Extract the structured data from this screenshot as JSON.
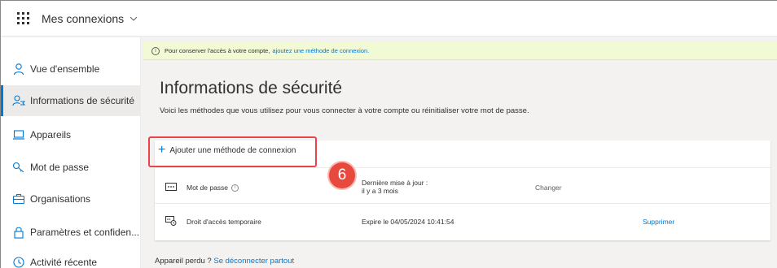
{
  "app": {
    "title": "Mes connexions"
  },
  "sidebar": {
    "items": [
      {
        "label": "Vue d'ensemble",
        "icon": "person-icon"
      },
      {
        "label": "Informations de sécurité",
        "icon": "security-info-icon",
        "active": true
      },
      {
        "label": "Appareils",
        "icon": "laptop-icon"
      },
      {
        "label": "Mot de passe",
        "icon": "key-icon"
      },
      {
        "label": "Organisations",
        "icon": "briefcase-icon"
      },
      {
        "label": "Paramètres et confiden...",
        "icon": "lock-icon"
      },
      {
        "label": "Activité récente",
        "icon": "history-icon"
      }
    ]
  },
  "banner": {
    "text": "Pour conserver l'accès à votre compte,",
    "link": "ajoutez une méthode de connexion."
  },
  "main": {
    "title": "Informations de sécurité",
    "description": "Voici les méthodes que vous utilisez pour vous connecter à votre compte ou réinitialiser votre mot de passe.",
    "add_method_label": "Ajouter une méthode de connexion",
    "step_number": "6",
    "methods": [
      {
        "name": "Mot de passe",
        "detail_line1": "Dernière mise à jour :",
        "detail_line2": "il y a 3 mois",
        "action": "Changer"
      },
      {
        "name": "Droit d'accès temporaire",
        "detail": "Expire le 04/05/2024 10:41:54",
        "action": "Supprimer"
      }
    ],
    "lost_device_text": "Appareil perdu ?",
    "lost_device_link": "Se déconnecter partout"
  },
  "colors": {
    "accent": "#0078d4",
    "highlight": "#e7454b",
    "banner_bg": "#f2f9d5"
  }
}
